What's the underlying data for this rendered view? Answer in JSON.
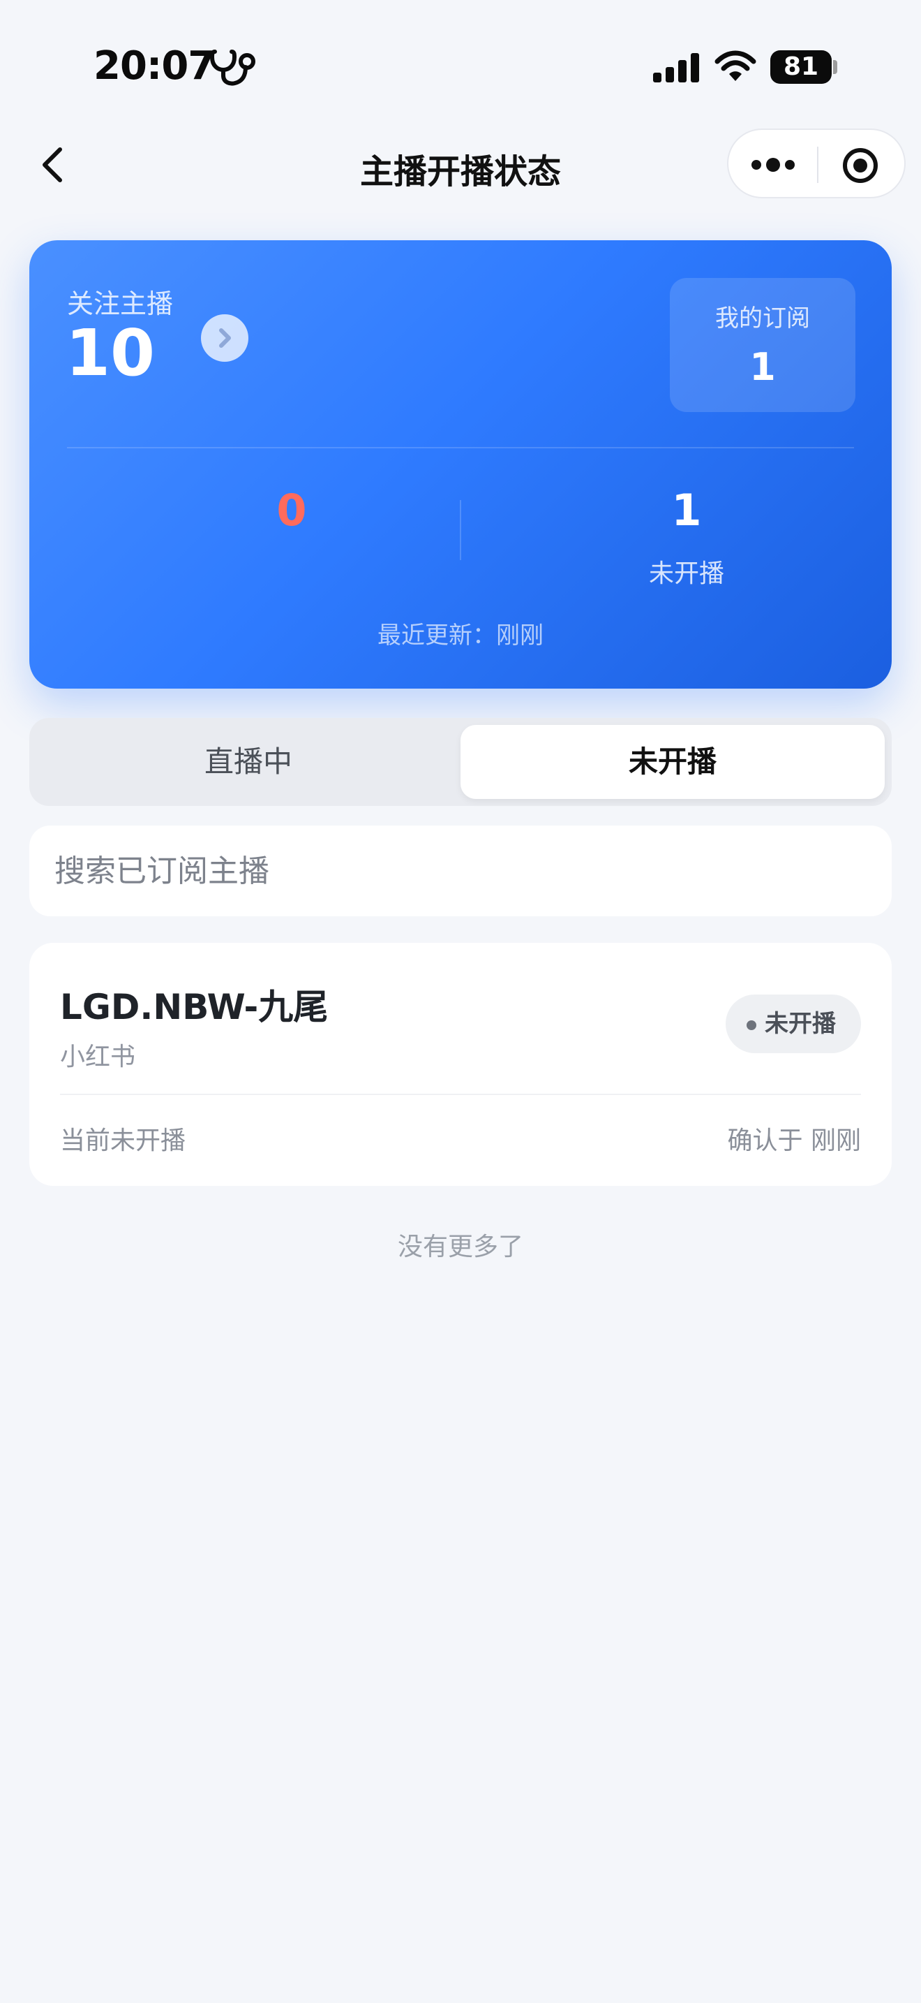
{
  "status_bar": {
    "time": "20:07",
    "battery": "81"
  },
  "nav": {
    "title": "主播开播状态"
  },
  "summary": {
    "follow_label": "关注主播",
    "follow_count": "10",
    "subscription_label": "我的订阅",
    "subscription_count": "1",
    "live_count": "0",
    "offline_count": "1",
    "offline_label": "未开播",
    "last_update": "最近更新：刚刚"
  },
  "tabs": [
    {
      "label": "直播中",
      "active": false
    },
    {
      "label": "未开播",
      "active": true
    }
  ],
  "search": {
    "placeholder": "搜索已订阅主播",
    "value": ""
  },
  "streamers": [
    {
      "name": "LGD.NBW-九尾",
      "platform": "小红书",
      "status": "未开播",
      "note": "当前未开播",
      "confirmed": "确认于 刚刚"
    }
  ],
  "footer": {
    "no_more": "没有更多了"
  },
  "colors": {
    "accent_blue": "#2f7bff",
    "live_red": "#ff6b5d",
    "page_bg": "#f4f6fa"
  },
  "icons": [
    "stethoscope-icon",
    "signal-icon",
    "wifi-icon",
    "battery-icon",
    "back-icon",
    "more-icon",
    "record-icon",
    "chevron-right-icon",
    "status-dot-icon"
  ]
}
